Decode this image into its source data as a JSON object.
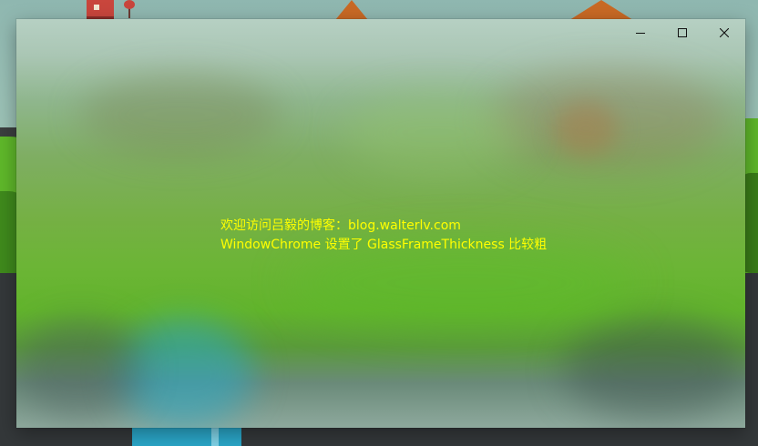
{
  "window": {
    "text_lines": [
      "欢迎访问吕毅的博客：blog.walterlv.com",
      "WindowChrome 设置了 GlassFrameThickness 比较粗"
    ],
    "text_color": "#ffff00",
    "caption_buttons": [
      {
        "icon": "minimize-icon"
      },
      {
        "icon": "maximize-icon"
      },
      {
        "icon": "close-icon"
      }
    ]
  }
}
